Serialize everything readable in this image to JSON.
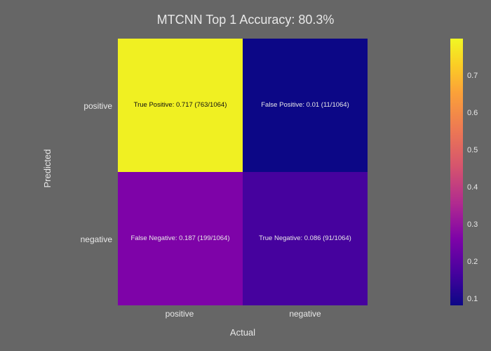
{
  "chart_data": {
    "type": "heatmap",
    "title": "MTCNN Top 1 Accuracy: 80.3%",
    "xlabel": "Actual",
    "ylabel": "Predicted",
    "x_categories": [
      "positive",
      "negative"
    ],
    "y_categories": [
      "positive",
      "negative"
    ],
    "values": [
      [
        0.717,
        0.01
      ],
      [
        0.187,
        0.086
      ]
    ],
    "cell_annotations": {
      "tp": "True Positive: 0.717 (763/1064)",
      "fp": "False Positive: 0.01 (11/1064)",
      "fn": "False Negative: 0.187 (199/1064)",
      "tn": "True Negative: 0.086 (91/1064)"
    },
    "colorbar": {
      "range": [
        0,
        0.717
      ],
      "ticks": [
        0.1,
        0.2,
        0.3,
        0.4,
        0.5,
        0.6,
        0.7
      ]
    }
  }
}
